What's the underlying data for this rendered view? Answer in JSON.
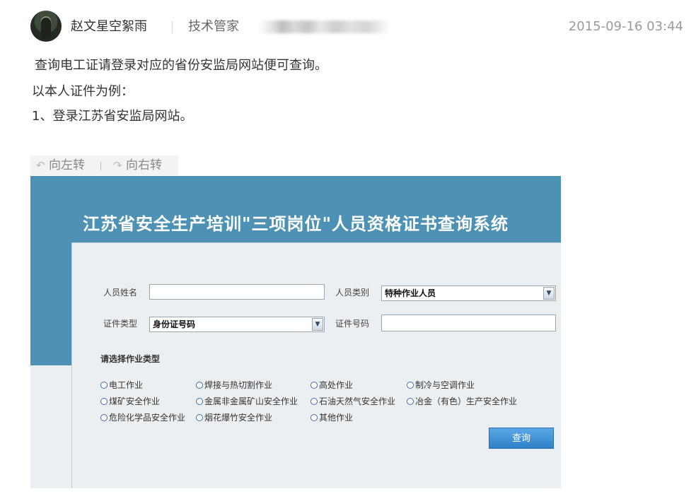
{
  "post": {
    "author": "赵文星空絮雨",
    "role": "技术管家",
    "date": "2015-09-16 03:44"
  },
  "content": {
    "lines": [
      "查询电工证请登录对应的省份安监局网站便可查询。",
      "以本人证件为例：",
      "1、登录江苏省安监局网站。"
    ]
  },
  "image_toolbar": {
    "rotate_left": "向左转",
    "rotate_right": "向右转"
  },
  "screenshot": {
    "title": "江苏省安全生产培训\"三项岗位\"人员资格证书查询系统",
    "form": {
      "name_label": "人员姓名",
      "category_label": "人员类别",
      "category_value": "特种作业人员",
      "id_type_label": "证件类型",
      "id_type_value": "身份证号码",
      "id_number_label": "证件号码",
      "section_title": "请选择作业类型",
      "options": [
        "电工作业",
        "焊接与热切割作业",
        "高处作业",
        "制冷与空调作业",
        "煤矿安全作业",
        "金属非金属矿山安全作业",
        "石油天然气安全作业",
        "冶金（有色）生产安全作业",
        "危险化学品安全作业",
        "烟花爆竹安全作业",
        "其他作业"
      ],
      "query_button": "查询"
    }
  },
  "colors": {
    "header_blue": "#4d92b4",
    "button_blue": "#3a8ad4",
    "date_gray": "#9a9a9a"
  }
}
